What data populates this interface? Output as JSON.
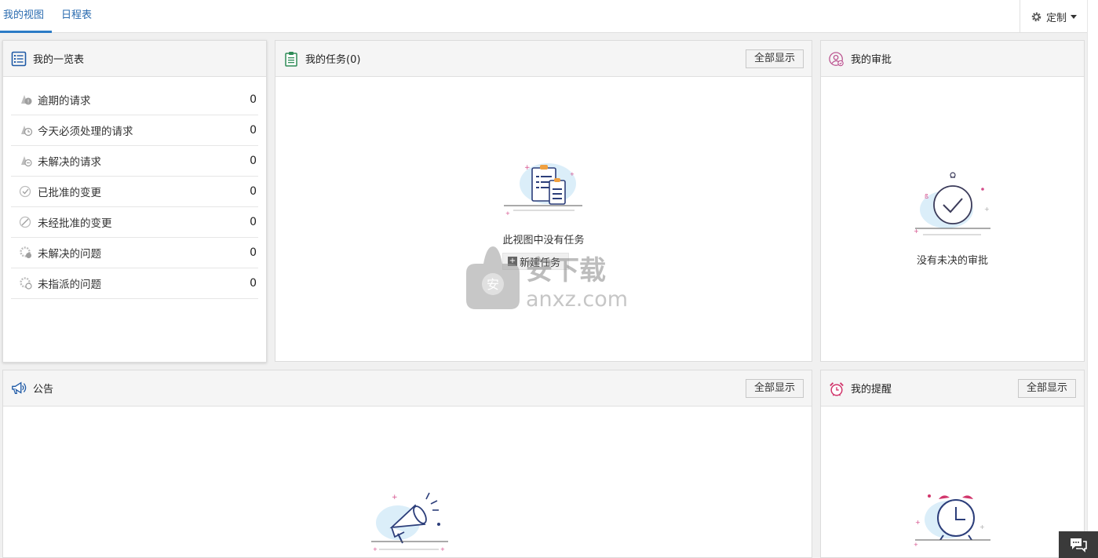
{
  "tabs": [
    {
      "label": "我的视图",
      "active": true
    },
    {
      "label": "日程表",
      "active": false
    }
  ],
  "customize_label": "定制",
  "accent_color": "#2b7bc6",
  "summary": {
    "title": "我的一览表",
    "rows": [
      {
        "label": "逾期的请求",
        "count": "0",
        "icon": "request-overdue-icon"
      },
      {
        "label": "今天必须处理的请求",
        "count": "0",
        "icon": "request-today-icon"
      },
      {
        "label": "未解决的请求",
        "count": "0",
        "icon": "request-open-icon"
      },
      {
        "label": "已批准的变更",
        "count": "0",
        "icon": "change-approved-icon"
      },
      {
        "label": "未经批准的变更",
        "count": "0",
        "icon": "change-unapproved-icon"
      },
      {
        "label": "未解决的问题",
        "count": "0",
        "icon": "problem-open-icon"
      },
      {
        "label": "未指派的问题",
        "count": "0",
        "icon": "problem-unassigned-icon"
      }
    ]
  },
  "tasks": {
    "title": "我的任务(0)",
    "show_all": "全部显示",
    "empty_text": "此视图中没有任务",
    "new_task": "新建任务"
  },
  "approval": {
    "title": "我的审批",
    "empty_text": "没有未决的审批"
  },
  "announcements": {
    "title": "公告",
    "show_all": "全部显示"
  },
  "reminders": {
    "title": "我的提醒",
    "show_all": "全部显示"
  },
  "watermark": {
    "line1": "安下载",
    "line2": "anxz.com",
    "badge": "安"
  }
}
